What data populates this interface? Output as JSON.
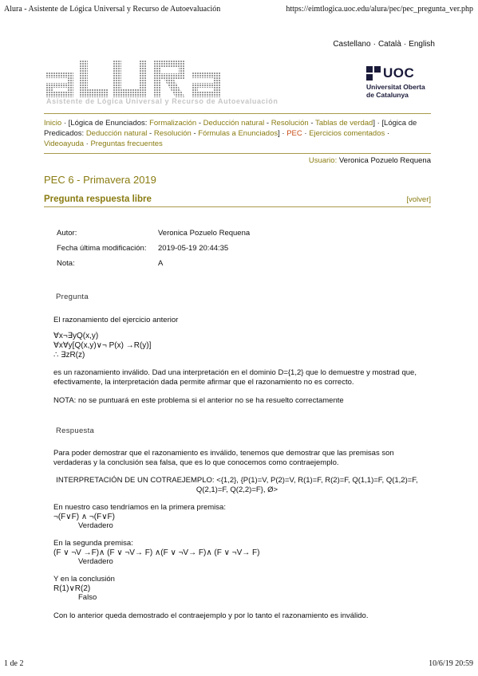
{
  "print": {
    "title": "Alura - Asistente de Lógica Universal y Recurso de Autoevaluación",
    "url": "https://eimtlogica.uoc.edu/alura/pec/pec_pregunta_ver.php",
    "page": "1 de 2",
    "datetime": "10/6/19 20:59"
  },
  "languages": [
    "Castellano",
    "Català",
    "English"
  ],
  "logo": {
    "alura": "aLURa",
    "subtitle": "Asistente de Lógica Universal y Recurso de Autoevaluación",
    "uoc": "UOC",
    "uoc_line1": "Universitat Oberta",
    "uoc_line2": "de Catalunya"
  },
  "nav": {
    "inicio": "Inicio",
    "enunciados_label": "[Lógica de Enunciados:",
    "formalizacion": "Formalización",
    "deduccion1": "Deducción natural",
    "resolucion1": "Resolución",
    "tablas": "Tablas de verdad",
    "predicados_label": "[Lógica de Predicados:",
    "deduccion2": "Deducción natural",
    "resolucion2": "Resolución",
    "formulas": "Fórmulas a Enunciados",
    "pec": "PEC",
    "ejercicios": "Ejercicios comentados",
    "videoayuda": "Videoayuda",
    "preguntas": "Preguntas frecuentes"
  },
  "user": {
    "label": "Usuario:",
    "name": "Veronica Pozuelo Requena"
  },
  "pec_title": "PEC 6 - Primavera 2019",
  "section_title": "Pregunta respuesta libre",
  "volver": "[volver]",
  "meta": {
    "autor_label": "Autor:",
    "autor": "Veronica Pozuelo Requena",
    "fecha_label": "Fecha última modificación:",
    "fecha": "2019-05-19 20:44:35",
    "nota_label": "Nota:",
    "nota": "A"
  },
  "pregunta": {
    "heading": "Pregunta",
    "intro": "El razonamiento del ejercicio anterior",
    "f1": "∀x¬∃yQ(x,y)",
    "f2": "∀x∀y[Q(x,y)∨¬ P(x) →R(y)]",
    "f3": "∴ ∃zR(z)",
    "body": "es un razonamiento inválido. Dad una interpretación en el dominio D={1,2} que lo demuestre y mostrad que, efectivamente, la interpretación dada permite afirmar que el razonamiento no es correcto.",
    "nota": "NOTA: no se puntuará en este problema si el anterior no se ha resuelto correctamente"
  },
  "respuesta": {
    "heading": "Respuesta",
    "p1": "Para poder demostrar que el razonamiento es inválido, tenemos que demostrar que las premisas son verdaderas y la conclusión sea falsa, que es lo que conocemos como contraejemplo.",
    "interp1": "INTERPRETACIÓN DE UN COTRAEJEMPLO: <{1,2}, {P(1)=V, P(2)=V, R(1)=F, R(2)=F, Q(1,1)=F, Q(1,2)=F,",
    "interp2": "Q(2,1)=F, Q(2,2)=F}, Ø>",
    "c1_label": "En nuestro caso tendríamos en la primera premisa:",
    "c1_formula": "¬(F∨F) ∧ ¬(F∨F)",
    "c1_result": "Verdadero",
    "c2_label": "En la segunda premisa:",
    "c2_formula": "(F ∨ ¬V →F)∧ (F ∨ ¬V→ F) ∧(F ∨ ¬V→ F)∧ (F ∨ ¬V→ F)",
    "c2_result": "Verdadero",
    "c3_label": "Y en la conclusión",
    "c3_formula": "R(1)∨R(2)",
    "c3_result": "Falso",
    "final": "Con lo anterior queda demostrado el contraejemplo y por lo tanto el razonamiento es inválido."
  }
}
